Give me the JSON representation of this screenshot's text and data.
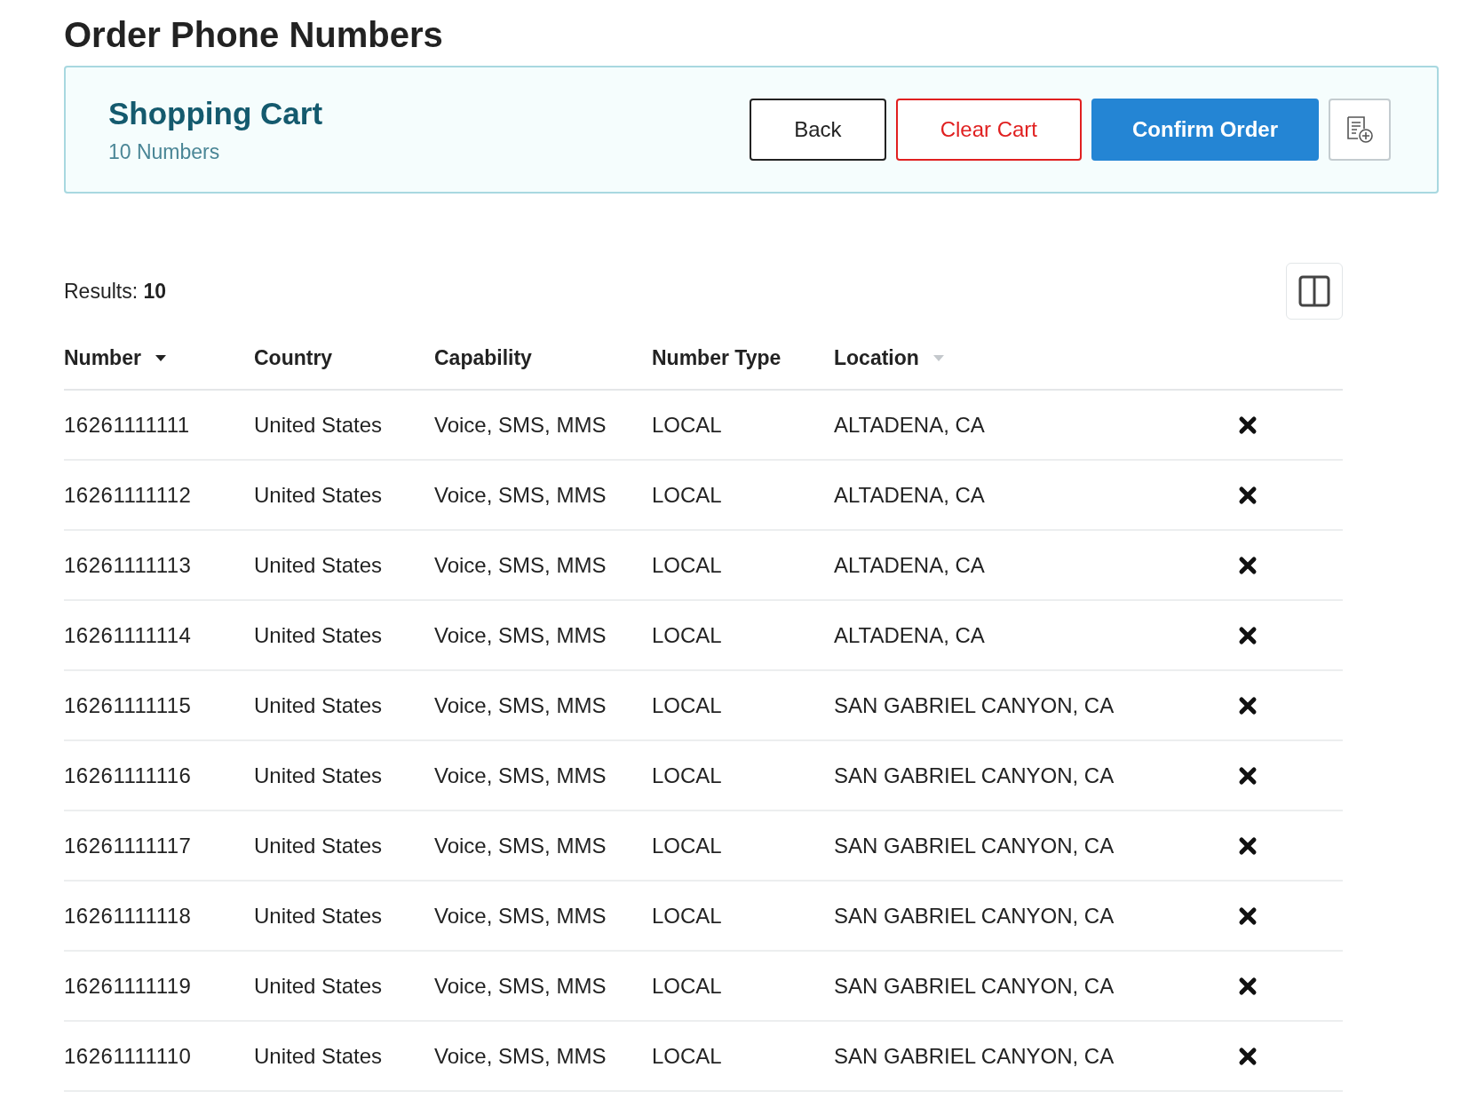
{
  "page": {
    "title": "Order Phone Numbers"
  },
  "cart": {
    "title": "Shopping Cart",
    "count": "10 Numbers",
    "buttons": [
      {
        "label": "Back",
        "kind": "outline"
      },
      {
        "label": "Clear Cart",
        "kind": "danger"
      },
      {
        "label": "Confirm Order",
        "kind": "primary"
      }
    ]
  },
  "results": {
    "label": "Results:",
    "count": "10"
  },
  "table": {
    "columns": [
      {
        "label": "Number",
        "sort_active": true
      },
      {
        "label": "Country"
      },
      {
        "label": "Capability"
      },
      {
        "label": "Number Type"
      },
      {
        "label": "Location",
        "sort_active": false
      }
    ],
    "rows": [
      [
        "16261111111",
        "United States",
        "Voice, SMS, MMS",
        "LOCAL",
        "ALTADENA, CA"
      ],
      [
        "16261111112",
        "United States",
        "Voice, SMS, MMS",
        "LOCAL",
        "ALTADENA, CA"
      ],
      [
        "16261111113",
        "United States",
        "Voice, SMS, MMS",
        "LOCAL",
        "ALTADENA, CA"
      ],
      [
        "16261111114",
        "United States",
        "Voice, SMS, MMS",
        "LOCAL",
        "ALTADENA, CA"
      ],
      [
        "16261111115",
        "United States",
        "Voice, SMS, MMS",
        "LOCAL",
        "SAN GABRIEL CANYON, CA"
      ],
      [
        "16261111116",
        "United States",
        "Voice, SMS, MMS",
        "LOCAL",
        "SAN GABRIEL CANYON, CA"
      ],
      [
        "16261111117",
        "United States",
        "Voice, SMS, MMS",
        "LOCAL",
        "SAN GABRIEL CANYON, CA"
      ],
      [
        "16261111118",
        "United States",
        "Voice, SMS, MMS",
        "LOCAL",
        "SAN GABRIEL CANYON, CA"
      ],
      [
        "16261111119",
        "United States",
        "Voice, SMS, MMS",
        "LOCAL",
        "SAN GABRIEL CANYON, CA"
      ],
      [
        "16261111110",
        "United States",
        "Voice, SMS, MMS",
        "LOCAL",
        "SAN GABRIEL CANYON, CA"
      ]
    ]
  }
}
